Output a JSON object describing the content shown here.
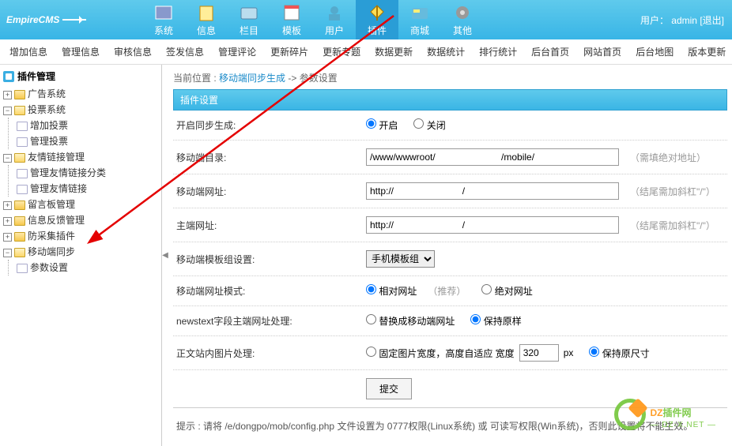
{
  "brand": "EmpireCMS",
  "user": {
    "label": "用户：",
    "name": "admin",
    "logout": "[退出]"
  },
  "topnav": [
    {
      "label": "系统"
    },
    {
      "label": "信息"
    },
    {
      "label": "栏目"
    },
    {
      "label": "模板"
    },
    {
      "label": "用户"
    },
    {
      "label": "插件",
      "active": true
    },
    {
      "label": "商城"
    },
    {
      "label": "其他"
    }
  ],
  "subnav": [
    "增加信息",
    "管理信息",
    "审核信息",
    "签发信息",
    "管理评论",
    "更新碎片",
    "更新专题",
    "数据更新",
    "数据统计",
    "排行统计",
    "后台首页",
    "网站首页",
    "后台地图",
    "版本更新"
  ],
  "sidebar": {
    "title": "插件管理",
    "nodes": [
      {
        "label": "广告系统",
        "type": "folder",
        "state": "closed"
      },
      {
        "label": "投票系统",
        "type": "folder",
        "state": "open",
        "children": [
          {
            "label": "增加投票",
            "type": "file"
          },
          {
            "label": "管理投票",
            "type": "file"
          }
        ]
      },
      {
        "label": "友情链接管理",
        "type": "folder",
        "state": "open",
        "children": [
          {
            "label": "管理友情链接分类",
            "type": "file"
          },
          {
            "label": "管理友情链接",
            "type": "file"
          }
        ]
      },
      {
        "label": "留言板管理",
        "type": "folder",
        "state": "closed"
      },
      {
        "label": "信息反馈管理",
        "type": "folder",
        "state": "closed"
      },
      {
        "label": "防采集插件",
        "type": "folder",
        "state": "closed"
      },
      {
        "label": "移动端同步",
        "type": "folder",
        "state": "open",
        "children": [
          {
            "label": "参数设置",
            "type": "file"
          }
        ]
      }
    ]
  },
  "crumb": {
    "prefix": "当前位置 : ",
    "link": "移动端同步生成",
    "sep": " -> ",
    "cur": "参数设置"
  },
  "panel_title": "插件设置",
  "form": {
    "enable": {
      "label": "开启同步生成:",
      "on": "开启",
      "off": "关闭"
    },
    "mdir": {
      "label": "移动端目录:",
      "value": "/www/wwwroot/                         /mobile/",
      "tip": "（需填绝对地址）"
    },
    "murl": {
      "label": "移动端网址:",
      "value": "http://                          /",
      "tip": "（结尾需加斜杠\"/\"）"
    },
    "purl": {
      "label": "主端网址:",
      "value": "http://                          /",
      "tip": "（结尾需加斜杠\"/\"）"
    },
    "tpl": {
      "label": "移动端模板组设置:",
      "value": "手机模板组"
    },
    "mode": {
      "label": "移动端网址模式:",
      "rel": "相对网址",
      "rel_tip": "（推荐）",
      "abs": "绝对网址"
    },
    "news": {
      "label": "newstext字段主端网址处理:",
      "replace": "替换成移动端网址",
      "keep": "保持原样"
    },
    "img": {
      "label": "正文站内图片处理:",
      "fix": "固定图片宽度，高度自适应 宽度",
      "width": "320",
      "px": "px",
      "keep": "保持原尺寸"
    },
    "submit": "提交"
  },
  "hint": "提示 : 请将 /e/dongpo/mob/config.php 文件设置为 0777权限(Linux系统) 或 可读写权限(Win系统)，否则此设置将不能生效。",
  "watermark": {
    "a": "DZ",
    "b": "插件网",
    "sub": "— DZ-X.NET —"
  }
}
